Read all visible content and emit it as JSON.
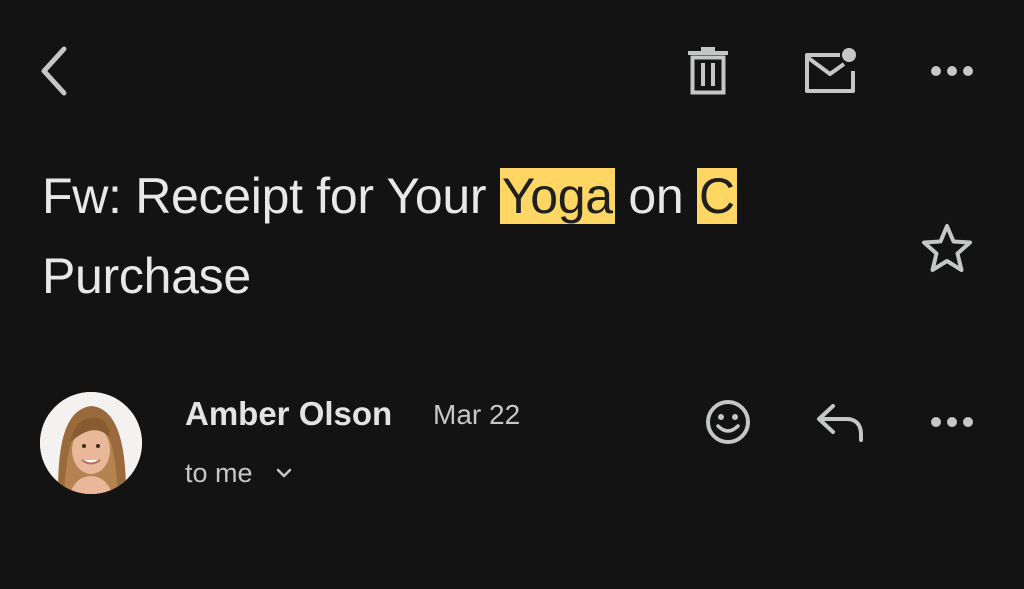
{
  "toolbar": {
    "back_icon": "arrow-back-icon",
    "delete_icon": "trash-icon",
    "mark_unread_icon": "mark-unread-mail-icon",
    "more_icon": "more-horizontal-icon"
  },
  "email": {
    "subject_parts": {
      "p1": "Fw: Receipt for Your ",
      "hl1": "Yoga",
      "p2": " on ",
      "hl2": "C",
      "p3": "Purchase"
    },
    "highlight_color": "#fdd663",
    "starred": false
  },
  "message": {
    "sender_name": "Amber Olson",
    "date": "Mar 22",
    "recipient_label": "to me",
    "actions": [
      "emoji-react-icon",
      "reply-icon",
      "more-horizontal-icon"
    ]
  },
  "colors": {
    "background": "#131314",
    "text_primary": "#e3e3e3",
    "text_secondary": "#c4c7c5"
  }
}
